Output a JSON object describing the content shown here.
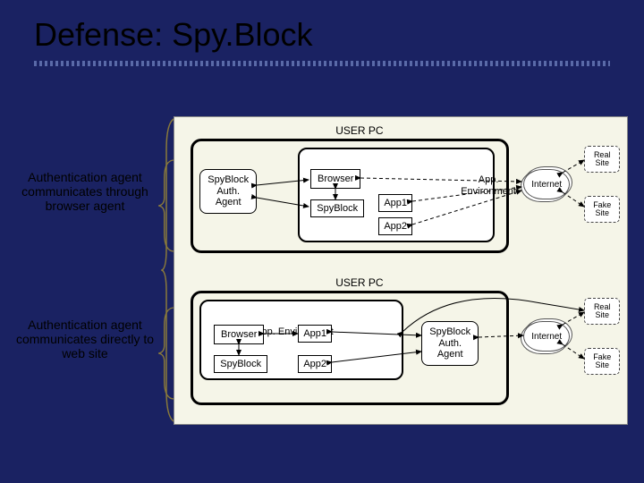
{
  "title": "Defense: Spy.Block",
  "captions": {
    "c1": "Authentication agent communicates through browser agent",
    "c2": "Authentication agent communicates directly to web site"
  },
  "scenario": {
    "userpc": "USER PC",
    "spyblock_auth": "SpyBlock\nAuth.\nAgent",
    "app_env": "App. Environment",
    "browser": "Browser",
    "spyblock": "SpyBlock",
    "app1": "App1",
    "app2": "App2",
    "internet": "Internet",
    "real_site": "Real\nSite",
    "fake_site": "Fake\nSite"
  }
}
